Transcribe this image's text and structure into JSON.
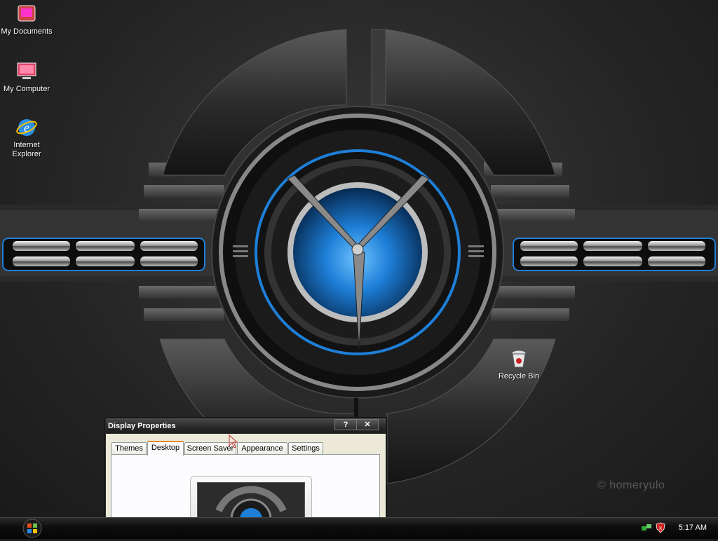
{
  "desktop_icons": [
    {
      "label": "My Documents",
      "icon": "my-documents-icon"
    },
    {
      "label": "My Computer",
      "icon": "my-computer-icon"
    },
    {
      "label": "Internet Explorer",
      "icon": "internet-explorer-icon"
    },
    {
      "label": "Recycle Bin",
      "icon": "recycle-bin-icon"
    }
  ],
  "watermark": "© homeryulo",
  "dialog": {
    "title": "Display Properties",
    "help_label": "?",
    "close_label": "✕",
    "tabs": [
      "Themes",
      "Desktop",
      "Screen Saver",
      "Appearance",
      "Settings"
    ],
    "active_tab": "Desktop"
  },
  "taskbar": {
    "start_icon": "windows-orb-icon",
    "tray_icons": [
      "network-icon",
      "security-shield-icon"
    ],
    "clock": "5:17 AM"
  },
  "colors": {
    "accent_blue": "#1e7fd8",
    "tab_highlight": "#e68b2c"
  }
}
